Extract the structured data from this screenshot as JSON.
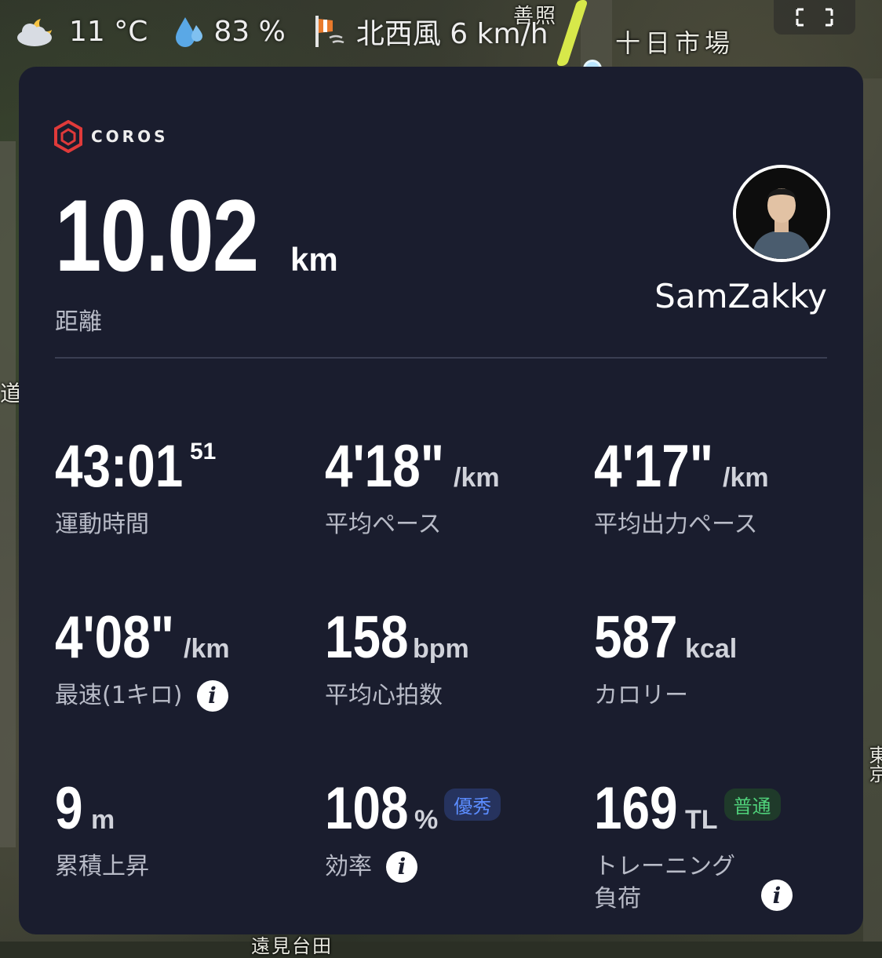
{
  "map": {
    "labels": [
      "十日市場",
      "善照",
      "道",
      "東京",
      "遠見台田"
    ]
  },
  "weather": {
    "temperature": "11 °C",
    "humidity": "83 %",
    "wind": "北西風 6 km/h",
    "icons": [
      "partly-cloudy-night-icon",
      "humidity-drop-icon",
      "wind-sock-icon"
    ]
  },
  "controls": {
    "expand_icon": "expand-icon"
  },
  "card": {
    "brand": "COROS",
    "distance": {
      "value": "10.02",
      "unit": "km",
      "label": "距離"
    },
    "user": {
      "name": "SamZakky"
    },
    "metrics": [
      {
        "value": "43:01",
        "sup": "51",
        "unit": "",
        "label": "運動時間"
      },
      {
        "value": "4'18\"",
        "unit": "/km",
        "label": "平均ペース"
      },
      {
        "value": "4'17\"",
        "unit": "/km",
        "label": "平均出力ペース"
      },
      {
        "value": "4'08\"",
        "unit": "/km",
        "label": "最速(1キロ)",
        "info": "i"
      },
      {
        "value": "158",
        "unit": "bpm",
        "label": "平均心拍数"
      },
      {
        "value": "587",
        "unit": "kcal",
        "label": "カロリー"
      },
      {
        "value": "9",
        "unit": "m",
        "label": "累積上昇"
      },
      {
        "value": "108",
        "unit": "%",
        "badge": "優秀",
        "label": "効率",
        "info": "i"
      },
      {
        "value": "169",
        "unit": "TL",
        "badge": "普通",
        "label": "トレーニング",
        "label2": "負荷",
        "info": "i"
      }
    ]
  },
  "colors": {
    "card_bg": "#1a1d2e",
    "route": "#d7e84a",
    "brand_red": "#e03a3a",
    "badge_blue": "#5b8cff",
    "badge_green": "#4fd07a"
  }
}
